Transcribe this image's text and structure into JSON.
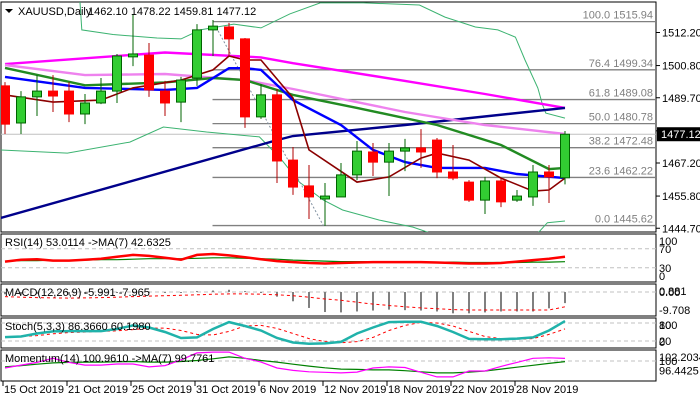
{
  "header": {
    "symbol_label": "XAUUSD,Daily",
    "ohlc_label": "1462.10 1478.22 1459.81 1477.12",
    "menu_icon": "triangle-down-icon"
  },
  "colors": {
    "bull": "#32cd32",
    "bull_edge": "#006400",
    "bear": "#ff0000",
    "bear_edge": "#b00000",
    "ma_magenta": "#ff00ff",
    "ma_navy": "#00008b",
    "ma_violet": "#ee82ee",
    "ma_green": "#228b22",
    "ma_blue": "#0000ff",
    "ma_darkred": "#8b0000",
    "bands": "#3cb371",
    "fib": "#808080",
    "rsi": "#ff0000",
    "rsi_ma": "#008000",
    "macd_hist": "#808080",
    "macd_signal": "#ff0000",
    "stoch_main": "#20b2aa",
    "stoch_signal": "#ff0000",
    "momentum": "#ff00ff",
    "momentum_ma": "#008000"
  },
  "chart_data": {
    "type": "candlestick",
    "title": "XAUUSD,Daily",
    "x_tick_labels": [
      "15 Oct 2019",
      "21 Oct 2019",
      "25 Oct 2019",
      "31 Oct 2019",
      "6 Nov 2019",
      "12 Nov 2019",
      "18 Nov 2019",
      "22 Nov 2019",
      "28 Nov 2019"
    ],
    "x_tick_every_bars": 4,
    "price_axis": {
      "labels": [
        "1512.20",
        "1500.80",
        "1489.70",
        "1478.30",
        "1467.20",
        "1455.80",
        "1444.70"
      ],
      "range": [
        1443,
        1522
      ]
    },
    "current_price": "1477.12",
    "ohlc": [
      [
        1493.8,
        1495.1,
        1477.2,
        1480.6
      ],
      [
        1481.0,
        1492.0,
        1477.2,
        1490.0
      ],
      [
        1490.0,
        1497.5,
        1483.4,
        1492.0
      ],
      [
        1492.0,
        1497.5,
        1484.8,
        1490.3
      ],
      [
        1492.0,
        1495.1,
        1481.3,
        1484.1
      ],
      [
        1484.1,
        1491.0,
        1480.6,
        1487.9
      ],
      [
        1487.9,
        1496.5,
        1487.5,
        1492.0
      ],
      [
        1492.0,
        1504.8,
        1487.9,
        1504.1
      ],
      [
        1503.8,
        1518.6,
        1500.6,
        1504.8
      ],
      [
        1504.4,
        1508.6,
        1490.0,
        1492.4
      ],
      [
        1492.0,
        1495.5,
        1483.4,
        1487.9
      ],
      [
        1488.2,
        1496.9,
        1481.3,
        1495.8
      ],
      [
        1496.5,
        1515.1,
        1493.8,
        1513.1
      ],
      [
        1513.1,
        1516.5,
        1504.1,
        1514.4
      ],
      [
        1514.1,
        1515.5,
        1504.4,
        1510.0
      ],
      [
        1510.0,
        1510.3,
        1479.3,
        1483.1
      ],
      [
        1483.1,
        1494.4,
        1482.4,
        1490.7
      ],
      [
        1490.7,
        1492.7,
        1460.3,
        1467.9
      ],
      [
        1468.2,
        1472.7,
        1456.2,
        1458.9
      ],
      [
        1459.3,
        1466.5,
        1447.9,
        1455.5
      ],
      [
        1454.8,
        1460.3,
        1445.5,
        1455.8
      ],
      [
        1455.5,
        1467.2,
        1455.5,
        1463.1
      ],
      [
        1463.1,
        1474.8,
        1461.3,
        1471.3
      ],
      [
        1471.0,
        1474.1,
        1462.7,
        1467.5
      ],
      [
        1467.5,
        1474.1,
        1455.8,
        1471.3
      ],
      [
        1471.3,
        1475.5,
        1464.4,
        1472.4
      ],
      [
        1472.4,
        1478.9,
        1465.5,
        1471.0
      ],
      [
        1475.1,
        1475.8,
        1462.0,
        1464.1
      ],
      [
        1464.1,
        1473.4,
        1461.3,
        1462.0
      ],
      [
        1460.6,
        1461.3,
        1453.8,
        1454.4
      ],
      [
        1454.4,
        1462.4,
        1449.6,
        1461.0
      ],
      [
        1461.0,
        1461.7,
        1452.0,
        1453.8
      ],
      [
        1454.4,
        1457.9,
        1453.8,
        1455.8
      ],
      [
        1455.5,
        1466.5,
        1452.4,
        1464.1
      ],
      [
        1464.1,
        1466.5,
        1453.4,
        1462.4
      ],
      [
        1462.1,
        1478.22,
        1459.81,
        1477.12
      ]
    ],
    "moving_averages": [
      {
        "name": "ma_magenta",
        "points": [
          [
            0,
            1501.3
          ],
          [
            10,
            1505.3
          ],
          [
            16,
            1503.6
          ],
          [
            18,
            1501.6
          ],
          [
            25,
            1495.5
          ],
          [
            30,
            1491.0
          ],
          [
            35,
            1486.2
          ]
        ]
      },
      {
        "name": "ma_navy",
        "points": [
          [
            -0.3,
            1448.2
          ],
          [
            17,
            1475.1
          ],
          [
            18,
            1476.5
          ],
          [
            25,
            1480.3
          ],
          [
            35,
            1486.2
          ]
        ]
      },
      {
        "name": "ma_violet",
        "points": [
          [
            0,
            1501.0
          ],
          [
            5,
            1497.5
          ],
          [
            10,
            1497.9
          ],
          [
            15,
            1495.8
          ],
          [
            18,
            1492.7
          ],
          [
            25,
            1484.8
          ],
          [
            30,
            1480.3
          ],
          [
            35,
            1477.2
          ]
        ]
      },
      {
        "name": "ma_green",
        "points": [
          [
            0,
            1500.0
          ],
          [
            5,
            1494.0
          ],
          [
            10,
            1495.0
          ],
          [
            13,
            1496.5
          ],
          [
            15,
            1495.8
          ],
          [
            18,
            1490.7
          ],
          [
            22,
            1486.2
          ],
          [
            27,
            1480.3
          ],
          [
            31,
            1473.4
          ],
          [
            34,
            1465.1
          ],
          [
            35,
            1465.5
          ]
        ]
      },
      {
        "name": "ma_blue",
        "points": [
          [
            0,
            1496.9
          ],
          [
            5,
            1493.1
          ],
          [
            10,
            1492.4
          ],
          [
            12,
            1493.1
          ],
          [
            14,
            1499.9
          ],
          [
            15,
            1499.9
          ],
          [
            16,
            1499.3
          ],
          [
            18,
            1488.9
          ],
          [
            21,
            1480.3
          ],
          [
            23,
            1471.7
          ],
          [
            25,
            1467.5
          ],
          [
            27,
            1465.5
          ],
          [
            30,
            1465.5
          ],
          [
            32,
            1463.4
          ],
          [
            35,
            1462.0
          ]
        ]
      },
      {
        "name": "ma_darkred",
        "points": [
          [
            0,
            1490.7
          ],
          [
            3,
            1488.2
          ],
          [
            6,
            1488.9
          ],
          [
            8,
            1493.1
          ],
          [
            11,
            1495.8
          ],
          [
            13,
            1499.3
          ],
          [
            14,
            1504.1
          ],
          [
            15,
            1502.7
          ],
          [
            16,
            1502.7
          ],
          [
            18,
            1489.6
          ],
          [
            19,
            1471.7
          ],
          [
            22,
            1460.6
          ],
          [
            24,
            1462.4
          ],
          [
            26,
            1468.9
          ],
          [
            27,
            1470.6
          ],
          [
            29,
            1468.2
          ],
          [
            31,
            1462.0
          ],
          [
            33,
            1457.5
          ],
          [
            34,
            1457.9
          ],
          [
            35,
            1462.0
          ]
        ]
      }
    ],
    "bands": {
      "upper": [
        [
          4.6,
          1530
        ],
        [
          4.8,
          1513.1
        ],
        [
          6.75,
          1511.5
        ],
        [
          9.5,
          1510.3
        ],
        [
          11,
          1510.0
        ],
        [
          12.2,
          1513.1
        ],
        [
          14.3,
          1515.1
        ],
        [
          16,
          1513.8
        ],
        [
          17.8,
          1518.6
        ],
        [
          19.7,
          1522.4
        ],
        [
          22.4,
          1522.4
        ],
        [
          25.9,
          1521.7
        ],
        [
          27.5,
          1517.5
        ],
        [
          29.4,
          1514.1
        ],
        [
          30.8,
          1513.1
        ],
        [
          31.9,
          1510.6
        ],
        [
          32.5,
          1502.7
        ],
        [
          33.3,
          1493.1
        ],
        [
          33.6,
          1487.2
        ],
        [
          33.8,
          1484.4
        ],
        [
          35,
          1482.7
        ]
      ],
      "lower": [
        [
          -0.3,
          1471.7
        ],
        [
          3.9,
          1470.6
        ],
        [
          7.8,
          1474.4
        ],
        [
          9.9,
          1479.6
        ],
        [
          12.6,
          1477.9
        ],
        [
          15.9,
          1476.2
        ],
        [
          17.2,
          1468.9
        ],
        [
          18.4,
          1460.6
        ],
        [
          19.9,
          1454.4
        ],
        [
          21.1,
          1451.0
        ],
        [
          23.4,
          1447.5
        ],
        [
          25.5,
          1445.1
        ],
        [
          26.6,
          1443.0
        ],
        [
          29,
          1436
        ],
        [
          32,
          1436
        ],
        [
          33.3,
          1443.0
        ],
        [
          33.9,
          1446.6
        ],
        [
          35,
          1447.2
        ]
      ]
    },
    "zigzag": [
      [
        13.2,
        1514.0
      ],
      [
        19.9,
        1445.6
      ]
    ],
    "fibonacci": [
      {
        "label": "100.0 1515.94",
        "price": 1515.94
      },
      {
        "label": "76.4 1499.34",
        "price": 1499.34
      },
      {
        "label": "61.8 1489.08",
        "price": 1489.08
      },
      {
        "label": "50.0 1480.78",
        "price": 1480.78
      },
      {
        "label": "38.2 1472.48",
        "price": 1472.48
      },
      {
        "label": "23.6 1462.22",
        "price": 1462.22
      },
      {
        "label": "0.0 1445.62",
        "price": 1445.62
      }
    ],
    "fib_start_bar": 13,
    "indicators": {
      "rsi": {
        "title": "RSI(14) 53.0114  ->MA(7) 42.6325",
        "axis_labels": [
          "100",
          "70",
          "30",
          "0"
        ],
        "levels": [
          70,
          30
        ],
        "range": [
          0,
          100
        ],
        "rsi": [
          43,
          47,
          48,
          45,
          45,
          47,
          49,
          53,
          57,
          55,
          51,
          47,
          57,
          59,
          56,
          52,
          48,
          44,
          42,
          40,
          39,
          40,
          41,
          42,
          42,
          42,
          42,
          41,
          40,
          39,
          39,
          40,
          43,
          46,
          49,
          53.0114
        ],
        "ma": [
          44,
          45,
          45,
          46,
          46,
          46,
          47,
          47,
          48,
          49,
          49,
          49,
          50,
          51,
          51,
          50,
          49,
          48,
          46,
          45,
          44,
          43,
          43,
          43,
          43,
          43,
          42,
          42,
          42,
          41,
          41,
          41,
          41,
          42,
          42,
          42.6325
        ]
      },
      "macd": {
        "title": "MACD(12,26,9) -5.991 -7.965",
        "axis_labels": [
          "0.881",
          "0.00",
          "-9.708"
        ],
        "axis_values": [
          0.881,
          0,
          -9.708
        ],
        "main": [
          -1.2,
          -1.5,
          -1,
          -0.8,
          -1.5,
          -1,
          -0.5,
          0,
          0.3,
          0.2,
          -0.2,
          0,
          0.5,
          0.8,
          1.2,
          0.5,
          -0.5,
          -2.5,
          -5,
          -8.6,
          -10.8,
          -11,
          -10.5,
          -10,
          -9.5,
          -9.8,
          -10,
          -10.5,
          -11.5,
          -11.5,
          -11,
          -10.5,
          -10.5,
          -10.5,
          -8.8,
          -5.991
        ],
        "signal": [
          -2.5,
          -2.8,
          -3,
          -3.2,
          -3.3,
          -3.2,
          -3,
          -2.8,
          -2.5,
          -2.2,
          -2,
          -1.8,
          -1.5,
          -1.2,
          -1,
          -1,
          -1.2,
          -1.5,
          -2,
          -2.8,
          -3.8,
          -4.5,
          -5.5,
          -6.5,
          -7.3,
          -8,
          -8.6,
          -9,
          -9.5,
          -9.7,
          -9.7,
          -9.7,
          -9.7,
          -9.7,
          -9.7,
          -7.965
        ]
      },
      "stoch": {
        "title": "Stoch(5,3,3) 86.3660 60.1980",
        "axis_labels": [
          "100",
          "80",
          "20",
          "0"
        ],
        "axis_values": [
          100,
          80,
          20,
          0
        ],
        "levels": [
          80,
          20
        ],
        "main": [
          33,
          35,
          45,
          52,
          53,
          53,
          53,
          60,
          72,
          65,
          50,
          30,
          32,
          60,
          83,
          70,
          55,
          30,
          15,
          11,
          12,
          17,
          45,
          65,
          83,
          84,
          84,
          70,
          50,
          27,
          26,
          26,
          28,
          32,
          55,
          86.366
        ],
        "signal": [
          35,
          35,
          38,
          44,
          48,
          50,
          52,
          54,
          58,
          63,
          63,
          55,
          42,
          40,
          52,
          70,
          72,
          62,
          45,
          28,
          18,
          14,
          18,
          32,
          55,
          72,
          82,
          80,
          70,
          52,
          35,
          28,
          26,
          28,
          42,
          60.198
        ]
      },
      "momentum": {
        "title": "Momentum(14) 100.9610  ->MA(7) 99.7761",
        "axis_labels": [
          "102.2034",
          "100",
          "96.4425"
        ],
        "axis_values": [
          102.2034,
          100,
          96.4425
        ],
        "levels": [
          100
        ],
        "momentum": [
          97.4,
          98.5,
          99.5,
          101,
          99.5,
          98.5,
          98.5,
          98.9,
          98.9,
          97.8,
          98.3,
          100.4,
          103,
          103.3,
          103.3,
          101,
          99.6,
          97.4,
          96.5,
          96,
          95.8,
          95.6,
          95.9,
          97.4,
          97.8,
          97.6,
          95.8,
          94.1,
          94.1,
          96.3,
          96.3,
          98,
          99.5,
          101,
          101.2,
          100.961
        ],
        "ma": [
          97.8,
          98.3,
          98.8,
          99.3,
          99.5,
          99.6,
          99.6,
          99.7,
          99.8,
          99.6,
          99.6,
          99.8,
          100.2,
          100.8,
          101.5,
          101.0,
          100.2,
          99.6,
          98.8,
          98.1,
          97.5,
          97.0,
          96.9,
          96.7,
          96.7,
          96.4,
          96.0,
          95.6,
          95.6,
          95.9,
          96.3,
          97.0,
          97.7,
          98.4,
          99.1,
          99.7761
        ]
      }
    }
  }
}
